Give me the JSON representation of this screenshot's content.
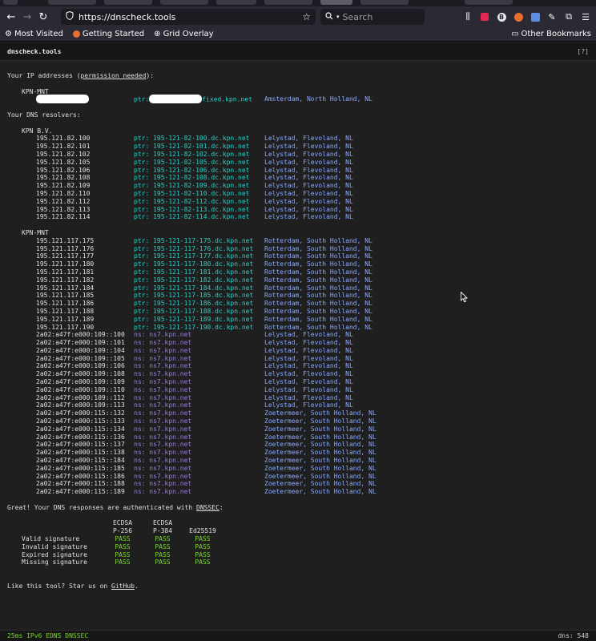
{
  "browser": {
    "url": "https://dnscheck.tools",
    "search_placeholder": "Search",
    "bookmarks": [
      "Most Visited",
      "Getting Started",
      "Grid Overlay"
    ],
    "other_bookmarks": "Other Bookmarks",
    "icons": [
      "back-icon",
      "forward-icon",
      "reload-icon",
      "shield-icon",
      "star-icon",
      "search-icon",
      "library-icon",
      "extension-icon",
      "menu-icon"
    ]
  },
  "site": {
    "title": "dnscheck.tools",
    "help": "[?]"
  },
  "ip_section": {
    "heading_prefix": "Your IP addresses (",
    "permission_link": "permission needed",
    "heading_suffix": "):",
    "org": "KPN-MNT",
    "ptr_prefix": "ptr:",
    "ptr_suffix": "fixed.kpn.net",
    "location": "Amsterdam, North Holland, NL"
  },
  "resolvers_heading": "Your DNS resolvers:",
  "resolver_groups": [
    {
      "org": "KPN B.V.",
      "entries": [
        {
          "ip": "195.121.82.100",
          "ptr": "ptr: 195-121-82-100.dc.kpn.net",
          "loc": "Lelystad, Flevoland, NL"
        },
        {
          "ip": "195.121.82.101",
          "ptr": "ptr: 195-121-82-101.dc.kpn.net",
          "loc": "Lelystad, Flevoland, NL"
        },
        {
          "ip": "195.121.82.102",
          "ptr": "ptr: 195-121-82-102.dc.kpn.net",
          "loc": "Lelystad, Flevoland, NL"
        },
        {
          "ip": "195.121.82.105",
          "ptr": "ptr: 195-121-82-105.dc.kpn.net",
          "loc": "Lelystad, Flevoland, NL"
        },
        {
          "ip": "195.121.82.106",
          "ptr": "ptr: 195-121-82-106.dc.kpn.net",
          "loc": "Lelystad, Flevoland, NL"
        },
        {
          "ip": "195.121.82.108",
          "ptr": "ptr: 195-121-82-108.dc.kpn.net",
          "loc": "Lelystad, Flevoland, NL"
        },
        {
          "ip": "195.121.82.109",
          "ptr": "ptr: 195-121-82-109.dc.kpn.net",
          "loc": "Lelystad, Flevoland, NL"
        },
        {
          "ip": "195.121.82.110",
          "ptr": "ptr: 195-121-82-110.dc.kpn.net",
          "loc": "Lelystad, Flevoland, NL"
        },
        {
          "ip": "195.121.82.112",
          "ptr": "ptr: 195-121-82-112.dc.kpn.net",
          "loc": "Lelystad, Flevoland, NL"
        },
        {
          "ip": "195.121.82.113",
          "ptr": "ptr: 195-121-82-113.dc.kpn.net",
          "loc": "Lelystad, Flevoland, NL"
        },
        {
          "ip": "195.121.82.114",
          "ptr": "ptr: 195-121-82-114.dc.kpn.net",
          "loc": "Lelystad, Flevoland, NL"
        }
      ]
    },
    {
      "org": "KPN-MNT",
      "entries": [
        {
          "ip": "195.121.117.175",
          "ptr": "ptr: 195-121-117-175.dc.kpn.net",
          "loc": "Rotterdam, South Holland, NL"
        },
        {
          "ip": "195.121.117.176",
          "ptr": "ptr: 195-121-117-176.dc.kpn.net",
          "loc": "Rotterdam, South Holland, NL"
        },
        {
          "ip": "195.121.117.177",
          "ptr": "ptr: 195-121-117-177.dc.kpn.net",
          "loc": "Rotterdam, South Holland, NL"
        },
        {
          "ip": "195.121.117.180",
          "ptr": "ptr: 195-121-117-180.dc.kpn.net",
          "loc": "Rotterdam, South Holland, NL"
        },
        {
          "ip": "195.121.117.181",
          "ptr": "ptr: 195-121-117-181.dc.kpn.net",
          "loc": "Rotterdam, South Holland, NL"
        },
        {
          "ip": "195.121.117.182",
          "ptr": "ptr: 195-121-117-182.dc.kpn.net",
          "loc": "Rotterdam, South Holland, NL"
        },
        {
          "ip": "195.121.117.184",
          "ptr": "ptr: 195-121-117-184.dc.kpn.net",
          "loc": "Rotterdam, South Holland, NL"
        },
        {
          "ip": "195.121.117.185",
          "ptr": "ptr: 195-121-117-185.dc.kpn.net",
          "loc": "Rotterdam, South Holland, NL"
        },
        {
          "ip": "195.121.117.186",
          "ptr": "ptr: 195-121-117-186.dc.kpn.net",
          "loc": "Rotterdam, South Holland, NL"
        },
        {
          "ip": "195.121.117.188",
          "ptr": "ptr: 195-121-117-188.dc.kpn.net",
          "loc": "Rotterdam, South Holland, NL"
        },
        {
          "ip": "195.121.117.189",
          "ptr": "ptr: 195-121-117-189.dc.kpn.net",
          "loc": "Rotterdam, South Holland, NL"
        },
        {
          "ip": "195.121.117.190",
          "ptr": "ptr: 195-121-117-190.dc.kpn.net",
          "loc": "Rotterdam, South Holland, NL"
        },
        {
          "ip": "2a02:a47f:e000:109::100",
          "ns": "ns: ns7.kpn.net",
          "loc": "Lelystad, Flevoland, NL"
        },
        {
          "ip": "2a02:a47f:e000:109::101",
          "ns": "ns: ns7.kpn.net",
          "loc": "Lelystad, Flevoland, NL"
        },
        {
          "ip": "2a02:a47f:e000:109::104",
          "ns": "ns: ns7.kpn.net",
          "loc": "Lelystad, Flevoland, NL"
        },
        {
          "ip": "2a02:a47f:e000:109::105",
          "ns": "ns: ns7.kpn.net",
          "loc": "Lelystad, Flevoland, NL"
        },
        {
          "ip": "2a02:a47f:e000:109::106",
          "ns": "ns: ns7.kpn.net",
          "loc": "Lelystad, Flevoland, NL"
        },
        {
          "ip": "2a02:a47f:e000:109::108",
          "ns": "ns: ns7.kpn.net",
          "loc": "Lelystad, Flevoland, NL"
        },
        {
          "ip": "2a02:a47f:e000:109::109",
          "ns": "ns: ns7.kpn.net",
          "loc": "Lelystad, Flevoland, NL"
        },
        {
          "ip": "2a02:a47f:e000:109::110",
          "ns": "ns: ns7.kpn.net",
          "loc": "Lelystad, Flevoland, NL"
        },
        {
          "ip": "2a02:a47f:e000:109::112",
          "ns": "ns: ns7.kpn.net",
          "loc": "Lelystad, Flevoland, NL"
        },
        {
          "ip": "2a02:a47f:e000:109::113",
          "ns": "ns: ns7.kpn.net",
          "loc": "Lelystad, Flevoland, NL"
        },
        {
          "ip": "2a02:a47f:e000:115::132",
          "ns": "ns: ns7.kpn.net",
          "loc": "Zoetermeer, South Holland, NL"
        },
        {
          "ip": "2a02:a47f:e000:115::133",
          "ns": "ns: ns7.kpn.net",
          "loc": "Zoetermeer, South Holland, NL"
        },
        {
          "ip": "2a02:a47f:e000:115::134",
          "ns": "ns: ns7.kpn.net",
          "loc": "Zoetermeer, South Holland, NL"
        },
        {
          "ip": "2a02:a47f:e000:115::136",
          "ns": "ns: ns7.kpn.net",
          "loc": "Zoetermeer, South Holland, NL"
        },
        {
          "ip": "2a02:a47f:e000:115::137",
          "ns": "ns: ns7.kpn.net",
          "loc": "Zoetermeer, South Holland, NL"
        },
        {
          "ip": "2a02:a47f:e000:115::138",
          "ns": "ns: ns7.kpn.net",
          "loc": "Zoetermeer, South Holland, NL"
        },
        {
          "ip": "2a02:a47f:e000:115::184",
          "ns": "ns: ns7.kpn.net",
          "loc": "Zoetermeer, South Holland, NL"
        },
        {
          "ip": "2a02:a47f:e000:115::185",
          "ns": "ns: ns7.kpn.net",
          "loc": "Zoetermeer, South Holland, NL"
        },
        {
          "ip": "2a02:a47f:e000:115::186",
          "ns": "ns: ns7.kpn.net",
          "loc": "Zoetermeer, South Holland, NL"
        },
        {
          "ip": "2a02:a47f:e000:115::188",
          "ns": "ns: ns7.kpn.net",
          "loc": "Zoetermeer, South Holland, NL"
        },
        {
          "ip": "2a02:a47f:e000:115::189",
          "ns": "ns: ns7.kpn.net",
          "loc": "Zoetermeer, South Holland, NL"
        }
      ]
    }
  ],
  "dnssec": {
    "heading_prefix": "Great! Your DNS responses are authenticated with ",
    "link": "DNSSEC",
    "heading_suffix": ":",
    "columns": [
      {
        "line1": "ECDSA",
        "line2": "P-256"
      },
      {
        "line1": "ECDSA",
        "line2": "P-384"
      },
      {
        "line1": "",
        "line2": "Ed25519"
      }
    ],
    "rows": [
      {
        "label": "Valid signature",
        "results": [
          "PASS",
          "PASS",
          "PASS"
        ]
      },
      {
        "label": "Invalid signature",
        "results": [
          "PASS",
          "PASS",
          "PASS"
        ]
      },
      {
        "label": "Expired signature",
        "results": [
          "PASS",
          "PASS",
          "PASS"
        ]
      },
      {
        "label": "Missing signature",
        "results": [
          "PASS",
          "PASS",
          "PASS"
        ]
      }
    ]
  },
  "star": {
    "prefix": "Like this tool? Star us on ",
    "link": "GitHub",
    "suffix": "."
  },
  "footer": {
    "status": "25ms IPv6 EDNS DNSSEC",
    "dns_count": "dns: 548"
  },
  "colors": {
    "ptr": "#27d1c7",
    "ns": "#9b7fd8",
    "location": "#89a9ff",
    "pass": "#7ad92a"
  }
}
